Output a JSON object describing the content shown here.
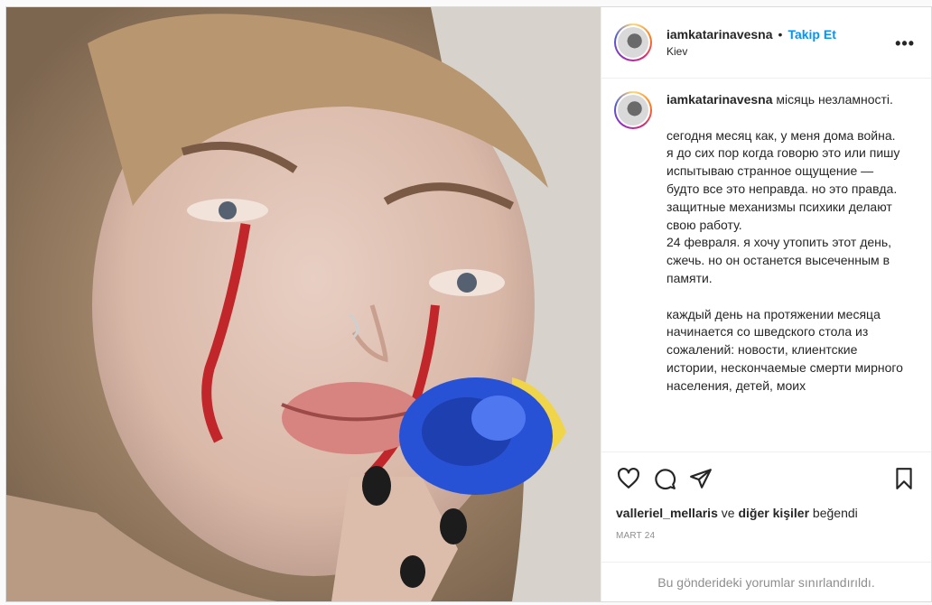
{
  "header": {
    "username": "iamkatarinavesna",
    "separator": "•",
    "follow_label": "Takip Et",
    "location": "Kiev",
    "more_label": "•••"
  },
  "caption": {
    "username": "iamkatarinavesna",
    "text": " місяць незламності.\n\nсегодня месяц как, у меня дома война.\nя до сих пор когда говорю это или пишу испытываю странное ощущение — будто все это неправда. но это правда.\nзащитные механизмы психики делают свою работу.\n24 февраля. я хочу утопить этот день, сжечь. но он останется высеченным в памяти.\n\nкаждый день на протяжении месяца начинается со шведского стола из сожалений: новости, клиентские истории, нескончаемые смерти мирного населения, детей, моих"
  },
  "actions": {
    "like_icon": "heart-icon",
    "comment_icon": "comment-icon",
    "share_icon": "paper-plane-icon",
    "save_icon": "bookmark-icon"
  },
  "likes": {
    "user": "valleriel_mellaris",
    "middle": " ve ",
    "others": "diğer kişiler",
    "suffix": " beğendi"
  },
  "date": "MART 24",
  "comments_restricted": "Bu gönderideki yorumlar sınırlandırıldı.",
  "colors": {
    "follow": "#0095f6",
    "muted": "#8e8e8e",
    "border": "#dbdbdb"
  }
}
